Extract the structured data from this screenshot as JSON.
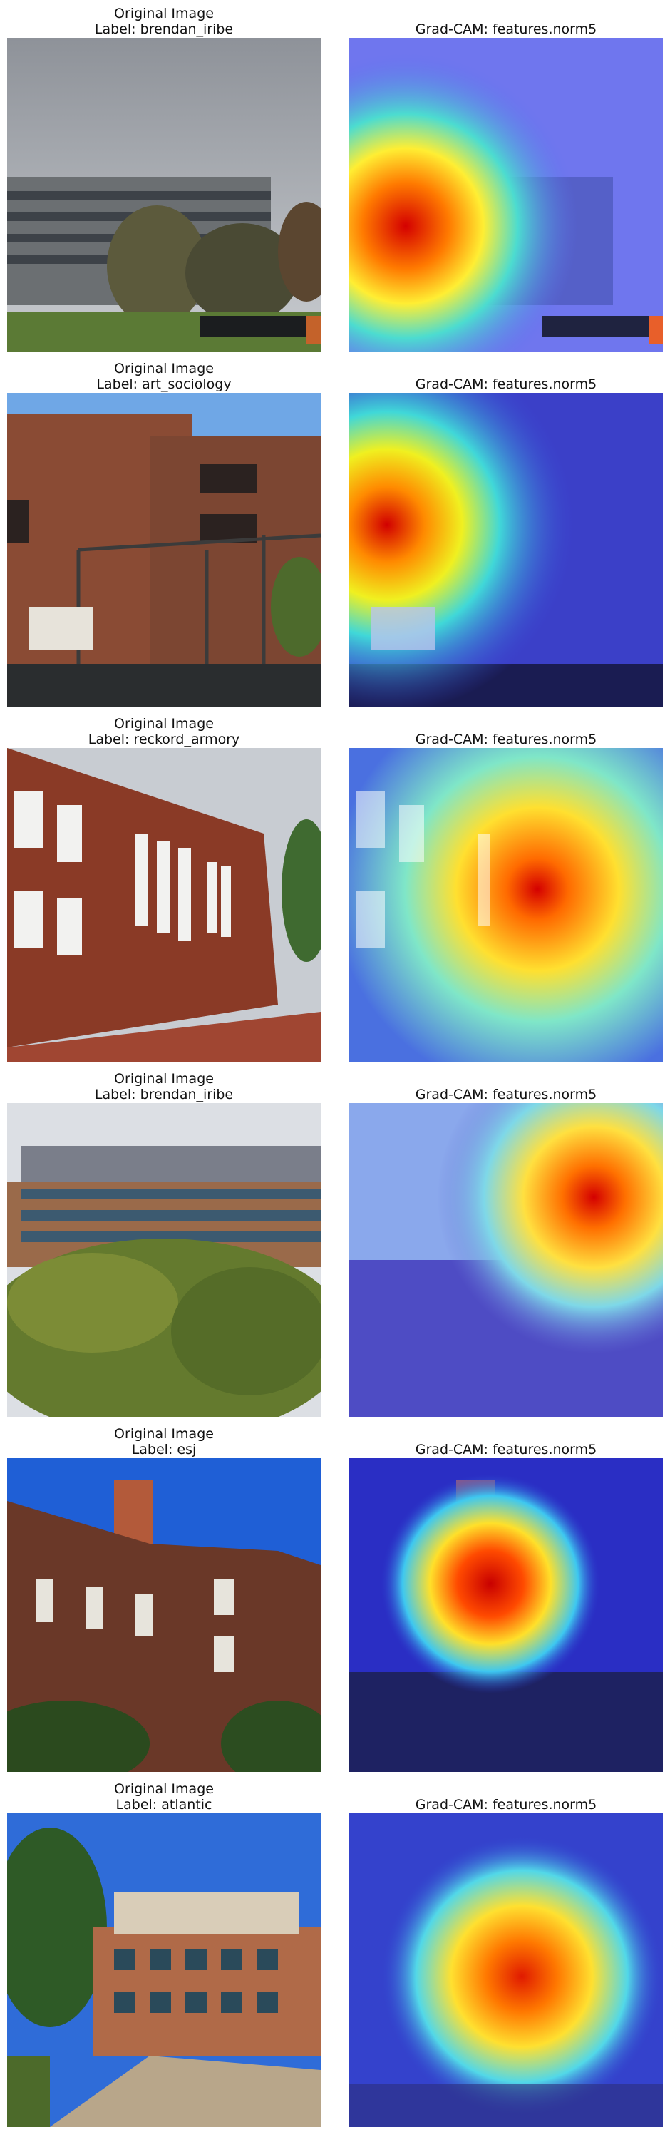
{
  "figure": {
    "rows": [
      {
        "original": {
          "title": "Original Image",
          "label": "Label: brendan_iribe"
        },
        "gradcam": {
          "title": "Grad-CAM: features.norm5"
        },
        "scene": "modern-building-trees"
      },
      {
        "original": {
          "title": "Original Image",
          "label": "Label: art_sociology"
        },
        "gradcam": {
          "title": "Grad-CAM: features.norm5"
        },
        "scene": "brick-block-building"
      },
      {
        "original": {
          "title": "Original Image",
          "label": "Label: reckord_armory"
        },
        "gradcam": {
          "title": "Grad-CAM: features.norm5"
        },
        "scene": "brick-wall-windows"
      },
      {
        "original": {
          "title": "Original Image",
          "label": "Label: brendan_iribe"
        },
        "gradcam": {
          "title": "Grad-CAM: features.norm5"
        },
        "scene": "glass-building-behind-trees"
      },
      {
        "original": {
          "title": "Original Image",
          "label": "Label: esj"
        },
        "gradcam": {
          "title": "Grad-CAM: features.norm5"
        },
        "scene": "brick-building-chimney"
      },
      {
        "original": {
          "title": "Original Image",
          "label": "Label: atlantic"
        },
        "gradcam": {
          "title": "Grad-CAM: features.norm5"
        },
        "scene": "brick-building-plaza"
      }
    ]
  }
}
